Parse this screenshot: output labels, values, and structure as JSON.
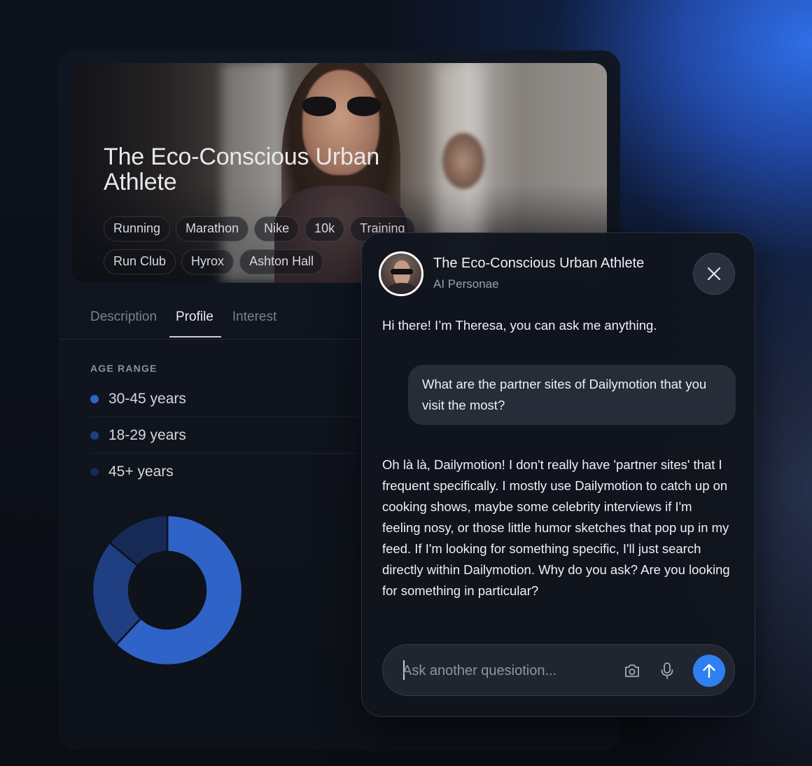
{
  "persona": {
    "title": "The Eco-Conscious Urban Athlete",
    "tags": [
      "Running",
      "Marathon",
      "Nike",
      "10k",
      "Training",
      "Run Club",
      "Hyrox",
      "Ashton Hall"
    ]
  },
  "tabs": [
    {
      "label": "Description",
      "active": false
    },
    {
      "label": "Profile",
      "active": true
    },
    {
      "label": "Interest",
      "active": false
    }
  ],
  "age_range": {
    "heading": "AGE RANGE",
    "items": [
      {
        "label": "30-45 years",
        "color": "#2f63c8",
        "share": 0.62
      },
      {
        "label": "18-29 years",
        "color": "#1f3f82",
        "share": 0.24
      },
      {
        "label": "45+ years",
        "color": "#162a55",
        "share": 0.14
      }
    ]
  },
  "chat": {
    "title": "The Eco-Conscious Urban Athlete",
    "subtitle": "AI Personae",
    "messages": [
      {
        "role": "bot",
        "text": "Hi there! I’m Theresa, you can ask me anything."
      },
      {
        "role": "user",
        "text": "What are the partner sites of Dailymotion that you visit the most?"
      },
      {
        "role": "bot",
        "text": "Oh là là, Dailymotion! I don't really have 'partner sites' that I frequent specifically. I mostly use Dailymotion to catch up on cooking shows, maybe some celebrity interviews if I'm feeling nosy, or those little humor sketches that pop up in my feed. If I'm looking for something specific, I'll just search directly within Dailymotion. Why do you ask? Are you looking for something in particular?"
      }
    ],
    "input_placeholder": "Ask another quesiotion...",
    "accent": "#2f7ff1"
  }
}
